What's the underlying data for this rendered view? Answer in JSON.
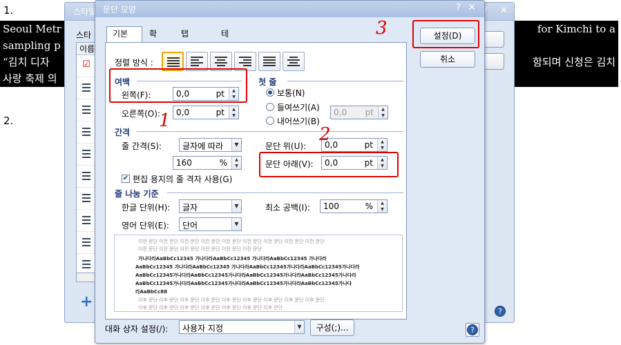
{
  "document": {
    "line1_number": "1.",
    "line2_number": "2.",
    "highlight_left_lines": [
      "Seoul Metr",
      "sampling p",
      "“김치 디자",
      "사랑 축제 의"
    ],
    "highlight_right_lines": [
      "for Kimchi to a",
      "",
      "함되며 신청은 김치",
      ""
    ]
  },
  "style_dialog": {
    "title": "스타일",
    "list_header": "이름",
    "tab_label": "스타",
    "add_button": "+",
    "help_icon": "?"
  },
  "paragraph_dialog": {
    "title": "문단 모양",
    "help_glyph": "?",
    "close_glyph": "✕",
    "tabs": [
      {
        "label": "기본",
        "active": true
      },
      {
        "label": "확장",
        "active": false
      },
      {
        "label": "탭 설정",
        "active": false
      },
      {
        "label": "테두리/배경",
        "active": false
      }
    ],
    "alignment_label": "정렬 방식 :",
    "alignment_active_index": 0,
    "margin": {
      "section": "여백",
      "left_label": "왼쪽(F):",
      "left_value": "0,0",
      "left_unit": "pt",
      "right_label": "오른쪽(O):",
      "right_value": "0,0",
      "right_unit": "pt"
    },
    "first_line": {
      "section": "첫 줄",
      "options": [
        "보통(N)",
        "들여쓰기(A)",
        "내어쓰기(B)"
      ],
      "selected_index": 0,
      "indent_value": "0,0",
      "indent_unit": "pt"
    },
    "spacing": {
      "section": "간격",
      "line_spacing_label": "줄 간격(S):",
      "line_spacing_type": "글자에 따라",
      "line_spacing_value": "160",
      "line_spacing_unit": "%",
      "above_label": "문단 위(U):",
      "above_value": "0,0",
      "above_unit": "pt",
      "below_label": "문단 아래(V):",
      "below_value": "0,0",
      "below_unit": "pt",
      "grid_checkbox_label": "편집 용지의 줄 격자 사용(G)",
      "grid_checked": true
    },
    "line_break": {
      "section": "줄 나눔 기준",
      "korean_label": "한글 단위(H):",
      "korean_value": "글자",
      "english_label": "영어 단위(E):",
      "english_value": "단어",
      "min_space_label": "최소 공백(I):",
      "min_space_value": "100",
      "min_space_unit": "%"
    },
    "preview_lines": {
      "gray_lines": [
        "이전 문단 이전 문단 이전 문단 이전 문단 이전 문단 이전 문단 이전 문단 이전 문단 이전 문단",
        "이전 문단 이전 문단 이전 문단 이전 문단 이전 문단 이전 문단"
      ],
      "dark_lines": [
        "가나다라AaBbCc12345     가나다라AaBbCc12345     가나다라AaBbCc12345     가나다라",
        "AaBbCc12345  가나다라AaBbCc12345  가나다라AaBbCc12345가나다라AaBbCc12345가나다라",
        "AaBbCc12345가나다라AaBbCc12345가나다라AaBbCc12345가나다라AaBbCc12345가나다라",
        "AaBbCc12345가나다라AaBbCc12345가나다라AaBbCc12345가나다라AaBbCc12345가나다",
        "라AaBbCc88"
      ],
      "after_lines": [
        "이후 문단 이후 문단 이후 문단 이후 문단 이후 문단 이후 문단 이후 문단 이후 문단 이후 문단",
        "이후 문단 이후 문단 이후 문단 이후 문단 이후 문단 이후 문단 이후 문단"
      ]
    },
    "bottom": {
      "dialog_setting_label": "대화 상자 설정(/):",
      "dialog_setting_value": "사용자 지정",
      "compose_button": "구성(;)..."
    },
    "ok_button": "설정(D)",
    "cancel_button": "취소"
  },
  "annotations": {
    "num1": "1",
    "num2": "2",
    "num3": "3"
  }
}
